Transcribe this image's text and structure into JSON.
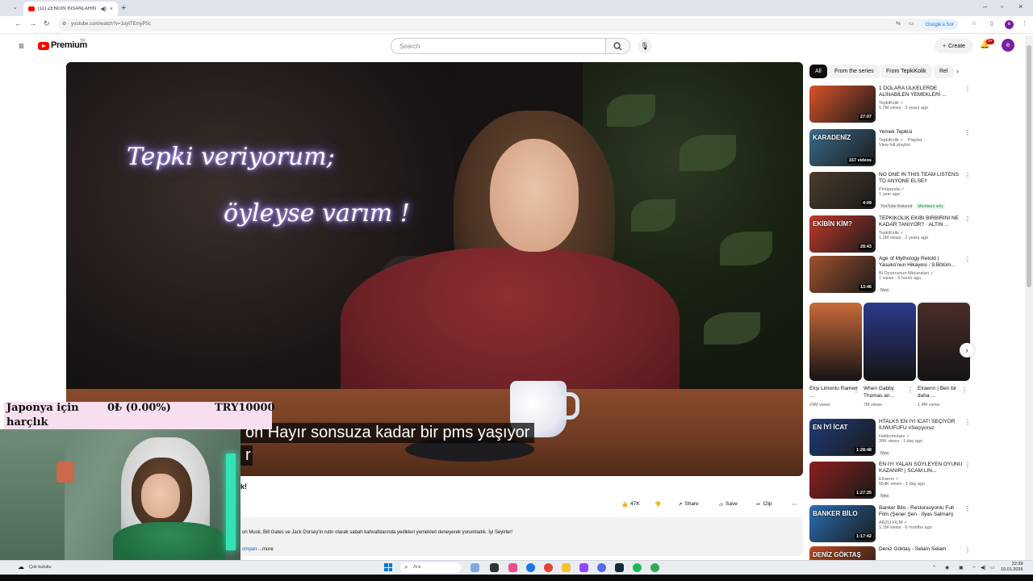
{
  "browser": {
    "tab_title": "(11) ZENGİN İNSANLARIN",
    "new_tab_glyph": "+",
    "url": "youtube.com/watch?v=1oyITEmyP5c",
    "google_sor": "Google'a Sor",
    "avatar_letter": "e"
  },
  "header": {
    "logo_text": "Premium",
    "logo_tm": "TR",
    "search_placeholder": "Search",
    "create_label": "Create",
    "notif_count": "9+",
    "avatar_letter": "e"
  },
  "video": {
    "neon_line1": "Tepki veriyorum;",
    "neon_line2": "öyleyse varım !",
    "subtitle_line1": "on Hayır sonsuza kadar bir pms yaşıyor",
    "subtitle_line2": "r",
    "title_fragment": "k!",
    "likes": "47K",
    "share_label": "Share",
    "save_label": "Save",
    "clip_label": "Clip",
    "description": "on Musk, Bill Gates ve Jack Dorsey'in rutin olarak sabah kahvaltılarında yedikleri yemekleri deneyerek yorumladık. İyi Seyirler!",
    "desc_link": "ompan",
    "more_label": "...more"
  },
  "chips": [
    "All",
    "From the series",
    "From TepkiKolik",
    "Rel"
  ],
  "recommendations": [
    {
      "title": "1 DOLARA ÜLKELERDE ALINABİLEN YEMEKLERİ ...",
      "channel": "TepkiKolik",
      "meta": "1.7M views · 3 years ago",
      "duration": "27:07",
      "tag": "",
      "color": "#d9532a"
    },
    {
      "title": "Yemek Tepkisi",
      "channel": "TepkiKolik",
      "meta": "View full playlist",
      "duration": "157 videos",
      "tag": "",
      "color": "#3b6b8c",
      "overlay_text": "KARADENİZ",
      "channel_suffix": "· Playlist"
    },
    {
      "title": "NO ONE IN THIS TEAM LISTENS TO ANYONE ELSE!!",
      "channel": "Pintipanda",
      "meta": "1 year ago",
      "duration": "4:09",
      "tag": "YouTube featured",
      "member": "Members only",
      "color": "#4a3c2a"
    },
    {
      "title": "TEPKİKOLİK EKİBİ BİRBİRİNİ NE KADAR TANIYOR? · ALTIN ...",
      "channel": "TepkiKolik",
      "meta": "1.2M views · 2 years ago",
      "duration": "28:43",
      "tag": "",
      "color": "#c0392b",
      "overlay_text": "EKİBİN KİM?"
    },
    {
      "title": "Age of Mythology Retold | Yasuko'nun Hikayesi - 9.Bölüm...",
      "channel": "Bi Oyuncunun Maceraları",
      "meta": "1 views · 5 hours ago",
      "duration": "13:46",
      "tag": "New",
      "color": "#a0522d"
    }
  ],
  "shorts": [
    {
      "title": "Ekşi Limonlu Ramen ...",
      "views": "24M views",
      "color": "#c96a3a"
    },
    {
      "title": "When Gabby Thomas an...",
      "views": "7M views",
      "color": "#2b3a8c"
    },
    {
      "title": "Elraenn | Ben bir daha ...",
      "views": "1.4M views",
      "color": "#4b2d2a"
    }
  ],
  "recommendations2": [
    {
      "title": "HTALKS EN İYİ İCAT! SEÇİYOR İUWUFUFU #Seçiyoruz",
      "channel": "Haltkomutanı",
      "meta": "30K views · 1 day ago",
      "duration": "1:28:48",
      "tag": "New",
      "color": "#1f3b7a",
      "overlay_text": "EN İYİ İCAT"
    },
    {
      "title": "EN İYİ YALAN SÖYLEYEN OYUNU KAZANIR! | SCAM LIN...",
      "channel": "Elraenn",
      "meta": "554K views · 1 day ago",
      "duration": "1:27:35",
      "tag": "New",
      "color": "#8c1f1f"
    },
    {
      "title": "Banker Bilo - Restorasyonlu Full Film (Şener Şen · İlyas Salman)",
      "channel": "ARZU FİLM",
      "meta": "1.1M views · 6 months ago",
      "duration": "1:17:42",
      "tag": "",
      "color": "#2a6fb3",
      "overlay_text": "BANKER BİLO"
    },
    {
      "title": "Deniz Göktaş - Selam Selam",
      "channel": "",
      "meta": "",
      "duration": "",
      "tag": "",
      "color": "#c04a1d",
      "overlay_text": "DENİZ GÖKTAŞ"
    }
  ],
  "ticker": {
    "label_line1": "Japonya için",
    "label_line2": "harçlık",
    "progress": "0₺ (0.00%)",
    "goal": "TRY10000"
  },
  "taskbar": {
    "weather": "Çok bulutlu",
    "search_placeholder": "Ara",
    "time": "22:39",
    "date": "19.01.2026"
  },
  "colors": {
    "yt_red": "#ff0000",
    "link_blue": "#065fd4",
    "ticker_bg": "#f7dff0"
  },
  "icons": [
    "menu-icon",
    "search-icon",
    "mic-icon",
    "bell-icon",
    "like-icon",
    "dislike-icon",
    "share-icon",
    "save-icon",
    "clip-icon",
    "more-icon"
  ]
}
